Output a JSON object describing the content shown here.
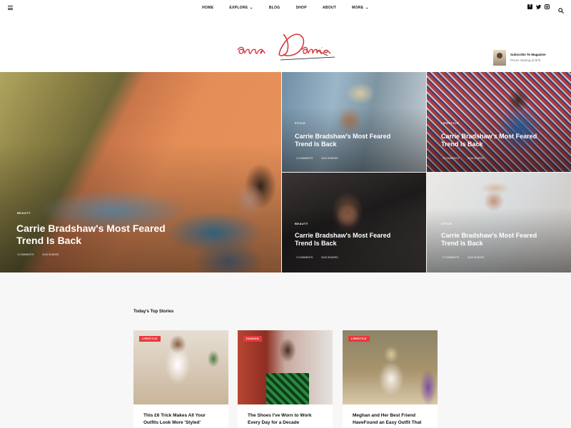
{
  "nav": {
    "items": [
      {
        "label": "HOME",
        "caret": false
      },
      {
        "label": "EXPLORE",
        "caret": true
      },
      {
        "label": "BLOG",
        "caret": false
      },
      {
        "label": "SHOP",
        "caret": false
      },
      {
        "label": "ABOUT",
        "caret": false
      },
      {
        "label": "MORE",
        "caret": true
      }
    ],
    "social": [
      "facebook-icon",
      "twitter-icon",
      "instagram-icon"
    ]
  },
  "header": {
    "logo_text": "annaDamie",
    "subscribe_title": "Subscribe To Magazine",
    "subscribe_price": "Prices starting at $76"
  },
  "hero": {
    "main": {
      "category": "BEAUTY",
      "title_line1": "Carrie Bradshaw's Most Feared",
      "title_line2": "Trend Is Back",
      "comments": "3 COMMENTS",
      "shares": "5416 SHARES"
    },
    "a": {
      "category": "STYLE",
      "title_line1": "Carrie Bradshaw's Most Feared",
      "title_line2": "Trend Is Back",
      "comments": "3 COMMENTS",
      "shares": "5416 SHARES"
    },
    "b": {
      "category": "LIFESTYLE",
      "title_line1": "Carrie Bradshaw's Most Feared",
      "title_line2": "Trend Is Back",
      "comments": "3 COMMENTS",
      "shares": "5416 SHARES"
    },
    "c": {
      "category": "BEAUTY",
      "title_line1": "Carrie Bradshaw's Most Feared",
      "title_line2": "Trend Is Back",
      "comments": "3 COMMENTS",
      "shares": "5416 SHARES"
    },
    "d": {
      "category": "STYLE",
      "title_line1": "Carrie Bradshaw's Most Feared",
      "title_line2": "Trend Is Back",
      "comments": "3 COMMENTS",
      "shares": "5416 SHARES"
    }
  },
  "top_stories": {
    "heading": "Today's Top Stories",
    "cards": [
      {
        "badge": "LIFESTYLE",
        "title": "This £6 Trick Makes All Your Outfits Look More 'Styled'"
      },
      {
        "badge": "FASHION",
        "title": "The Shoes I've Worn to Work Every Day for a Decade"
      },
      {
        "badge": "LIFESTYLE",
        "title": "Meghan and Her Best Friend HaveFound an Easy Outfit That"
      }
    ]
  },
  "colors": {
    "accent": "#e8383d",
    "text": "#111111",
    "background": "#f7f7f7"
  }
}
